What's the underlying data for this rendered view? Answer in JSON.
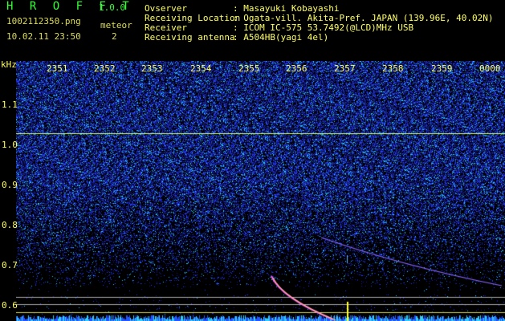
{
  "header": {
    "app_title": "H R O F F T",
    "version": "1.0.0",
    "filename": "1002112350.png",
    "datetime": "10.02.11 23:50",
    "meteor_label": "meteor",
    "meteor_count": "2",
    "fields": [
      {
        "label": "Ovserver",
        "value": ": Masayuki Kobayashi"
      },
      {
        "label": "Receiving Location",
        "value": ": Ogata-vill. Akita-Pref. JAPAN (139.96E, 40.02N)"
      },
      {
        "label": "Receiver",
        "value": ": ICOM IC-575 53.7492(@LCD)MHz USB"
      },
      {
        "label": "Receiving antenna",
        "value": ": A504HB(yagi 4el)"
      }
    ]
  },
  "y_axis": {
    "unit": "kHz",
    "ticks": [
      "1.1",
      "1.0",
      "0.9",
      "0.8",
      "0.7",
      "0.6"
    ]
  },
  "x_axis": {
    "ticks": [
      "2351",
      "2352",
      "2353",
      "2354",
      "2355",
      "2356",
      "2357",
      "2358",
      "2359",
      "0000"
    ]
  },
  "colors": {
    "background": "#000000",
    "noise_blue": "#2a3cff",
    "noise_cyan": "#33ddff",
    "label_yellow": "#ffff66",
    "title_green": "#33ff33",
    "marker_line": "#ccff66",
    "meteor_trace": "#ff66ff"
  }
}
